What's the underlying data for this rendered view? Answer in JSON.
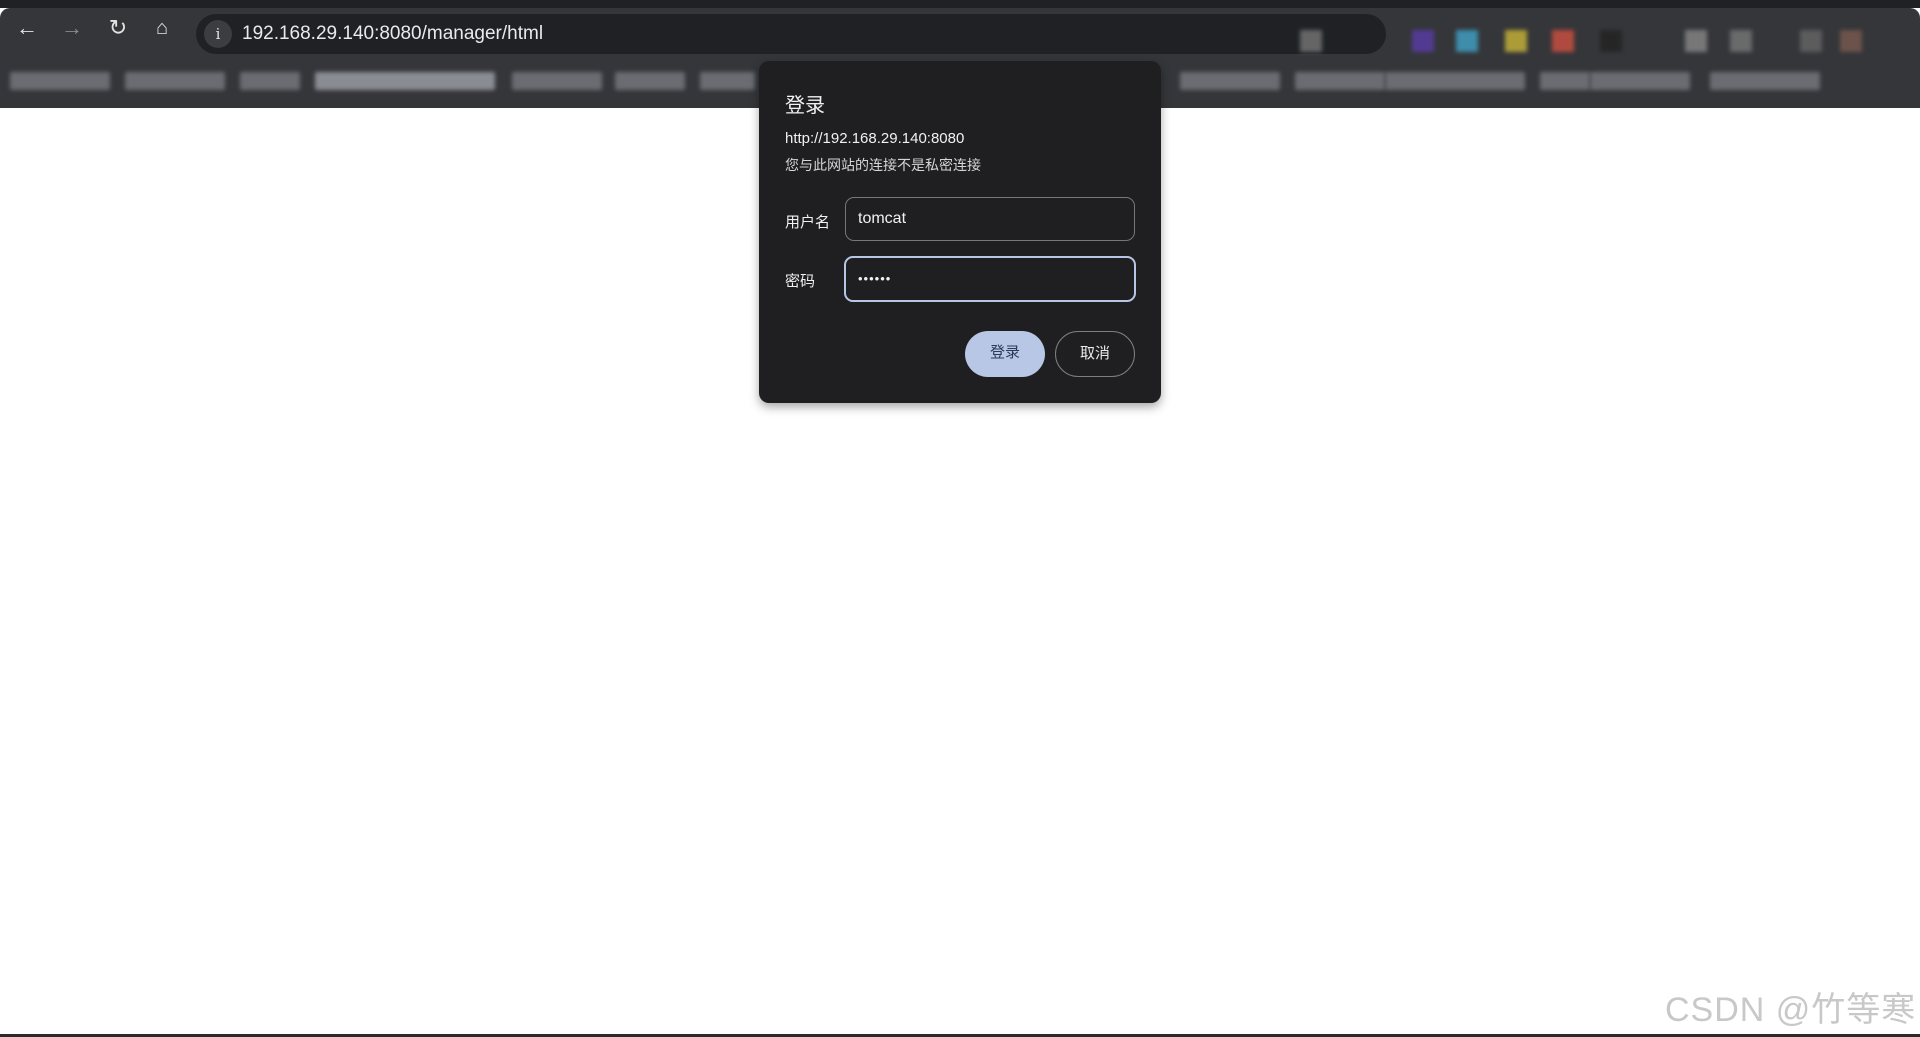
{
  "browser": {
    "url": "192.168.29.140:8080/manager/html",
    "icons": [
      "back-arrow-icon",
      "forward-arrow-icon",
      "reload-icon",
      "home-icon",
      "info-icon"
    ]
  },
  "dialog": {
    "title": "登录",
    "origin": "http://192.168.29.140:8080",
    "warning": "您与此网站的连接不是私密连接",
    "username_label": "用户名",
    "username_value": "tomcat",
    "password_label": "密码",
    "password_value": "••••••",
    "login_button": "登录",
    "cancel_button": "取消",
    "accent": "#b8c7e6"
  },
  "watermark": "CSDN @竹等寒"
}
